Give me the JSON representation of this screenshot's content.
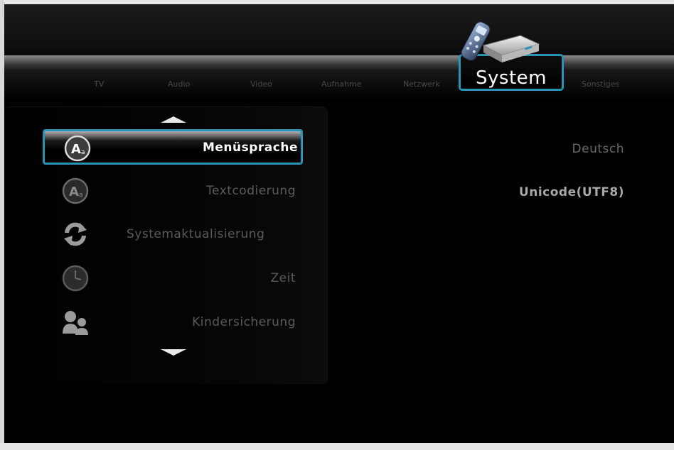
{
  "tabs": [
    {
      "label": "TV"
    },
    {
      "label": "Audio"
    },
    {
      "label": "Video"
    },
    {
      "label": "Aufnahme"
    },
    {
      "label": "Netzwerk"
    },
    {
      "label": "System"
    },
    {
      "label": "Sonstiges"
    }
  ],
  "active_tab": {
    "label": "System",
    "accent": "#2b93b3"
  },
  "menu": {
    "items": [
      {
        "label": "Menüsprache",
        "icon": "language-icon",
        "value": "Deutsch",
        "selected": true
      },
      {
        "label": "Textcodierung",
        "icon": "text-encoding-icon",
        "value": "Unicode(UTF8)"
      },
      {
        "label": "Systemaktualisierung",
        "icon": "refresh-icon",
        "value": ""
      },
      {
        "label": "Zeit",
        "icon": "clock-icon",
        "value": ""
      },
      {
        "label": "Kindersicherung",
        "icon": "parental-control-icon",
        "value": ""
      }
    ],
    "scroll_up_icon": "arrow-up-icon",
    "scroll_down_icon": "arrow-down-icon"
  },
  "colors": {
    "background": "#000000",
    "highlight_border": "#2b93b3",
    "selected_text": "#ffffff",
    "dim_text": "#5a5a5a"
  }
}
